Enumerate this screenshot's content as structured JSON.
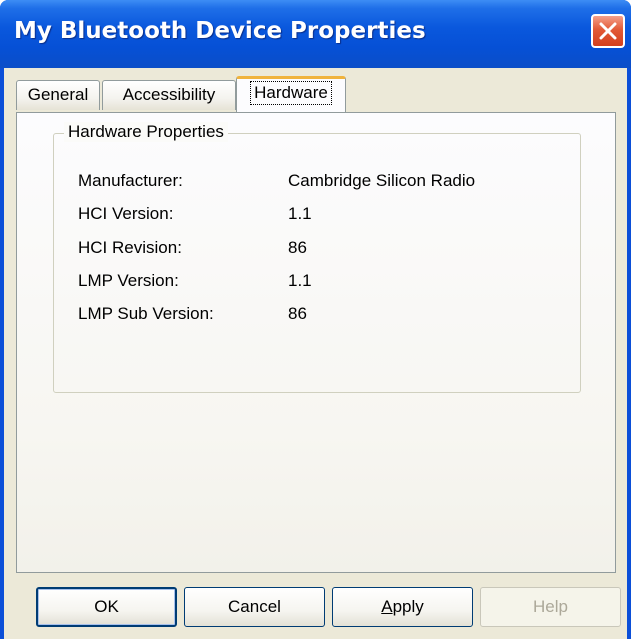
{
  "window": {
    "title": "My Bluetooth Device Properties"
  },
  "tabs": [
    {
      "label": "General",
      "active": false
    },
    {
      "label": "Accessibility",
      "active": false
    },
    {
      "label": "Hardware",
      "active": true
    }
  ],
  "hardware": {
    "group_title": "Hardware Properties",
    "properties": [
      {
        "label": "Manufacturer:",
        "value": "Cambridge Silicon Radio"
      },
      {
        "label": "HCI Version:",
        "value": "1.1"
      },
      {
        "label": "HCI Revision:",
        "value": "86"
      },
      {
        "label": "LMP Version:",
        "value": "1.1"
      },
      {
        "label": "LMP Sub Version:",
        "value": "86"
      }
    ]
  },
  "buttons": {
    "ok": "OK",
    "cancel": "Cancel",
    "apply": "Apply",
    "help": "Help"
  },
  "colors": {
    "titlebar": "#0650d6",
    "close_button": "#e25a37",
    "dialog_face": "#ece9d8",
    "active_tab_accent": "#f0b33c",
    "disabled_text": "#aca899"
  },
  "icons": {
    "close": "close-x-icon"
  }
}
